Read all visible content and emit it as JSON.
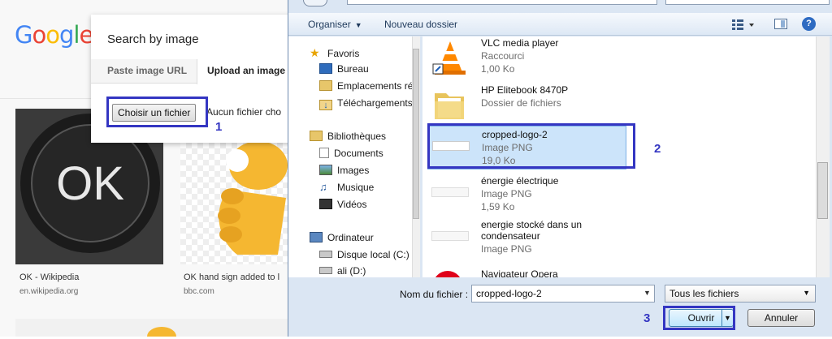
{
  "colors": {
    "annotation": "#3436c2",
    "toolbar_text": "#1e395b",
    "selection": "#cce4fa"
  },
  "google": {
    "logo": "Google",
    "results": [
      {
        "title": "OK - Wikipedia",
        "site": "en.wikipedia.org",
        "image_text": "OK"
      },
      {
        "title": "OK hand sign added to l",
        "site": "bbc.com"
      }
    ]
  },
  "search_by_image": {
    "title": "Search by image",
    "tabs": [
      "Paste image URL",
      "Upload an image"
    ],
    "choose_button": "Choisir un fichier",
    "no_file_text": "Aucun fichier cho"
  },
  "dialog": {
    "toolbar": {
      "organize": "Organiser",
      "organize_arrow": "▼",
      "new_folder": "Nouveau dossier",
      "views_icon": "view-options-icon",
      "help": "?"
    },
    "nav": {
      "favorites": {
        "label": "Favoris",
        "items": [
          "Bureau",
          "Emplacements ré",
          "Téléchargements"
        ]
      },
      "libraries": {
        "label": "Bibliothèques",
        "items": [
          "Documents",
          "Images",
          "Musique",
          "Vidéos"
        ]
      },
      "computer": {
        "label": "Ordinateur",
        "items": [
          "Disque local (C:)",
          "ali (D:)"
        ]
      }
    },
    "files": [
      {
        "name": "VLC media player",
        "type": "Raccourci",
        "size": "1,00 Ko",
        "icon": "vlc-icon"
      },
      {
        "name": "HP Elitebook 8470P",
        "type": "Dossier de fichiers",
        "size": "",
        "icon": "folder-icon"
      },
      {
        "name": "cropped-logo-2",
        "type": "Image PNG",
        "size": "19,0 Ko",
        "icon": "png-thumbnail-icon"
      },
      {
        "name": "énergie électrique",
        "type": "Image PNG",
        "size": "1,59 Ko",
        "icon": "png-thumbnail-icon"
      },
      {
        "name": "energie stocké dans un",
        "name2": "condensateur",
        "type": "Image PNG",
        "size": "",
        "icon": "png-thumbnail-icon"
      },
      {
        "name": "Navigateur Opera",
        "type": "",
        "size": "",
        "icon": "opera-icon"
      }
    ],
    "filename_label": "Nom du fichier :",
    "filename_value": "cropped-logo-2",
    "filetype_value": "Tous les fichiers",
    "open_button": "Ouvrir",
    "cancel_button": "Annuler"
  },
  "annotations": {
    "step1": "1",
    "step2": "2",
    "step3": "3"
  }
}
